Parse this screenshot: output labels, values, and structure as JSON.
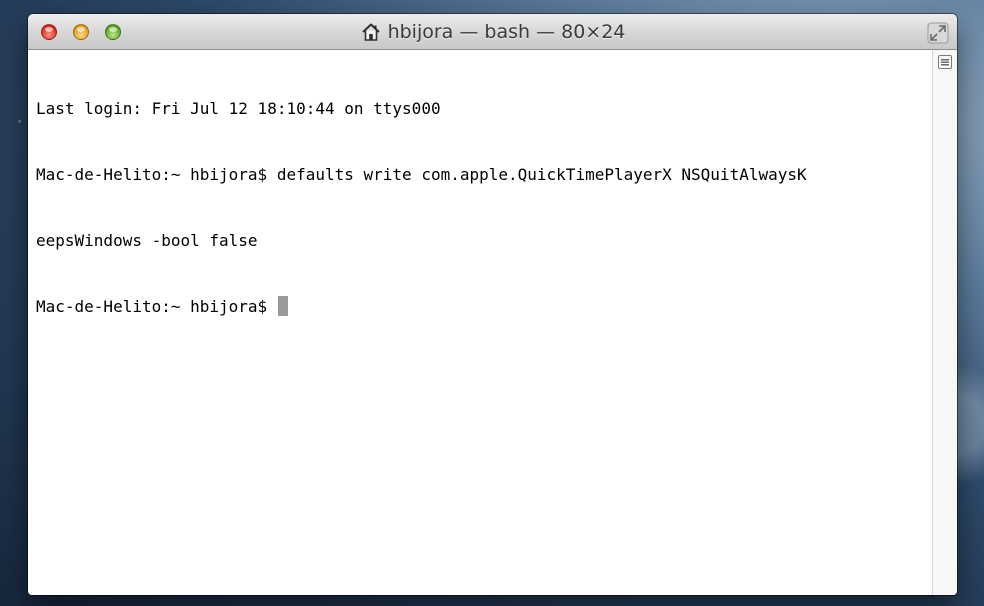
{
  "window": {
    "title": "hbijora — bash — 80×24",
    "icons": {
      "title_proxy": "home-icon",
      "fullscreen": "fullscreen-icon",
      "scroll_menu": "split-view-icon"
    },
    "controls": {
      "close": "close-button",
      "minimize": "minimize-button",
      "zoom": "zoom-button"
    }
  },
  "terminal": {
    "lines": [
      "Last login: Fri Jul 12 18:10:44 on ttys000",
      "Mac-de-Helito:~ hbijora$ defaults write com.apple.QuickTimePlayerX NSQuitAlwaysK",
      "eepsWindows -bool false",
      "Mac-de-Helito:~ hbijora$ "
    ],
    "cursor_visible": true
  },
  "colors": {
    "close": "#d8291c",
    "minimize": "#e39a10",
    "zoom": "#5aa31d",
    "cursor": "#9a9a9a"
  }
}
